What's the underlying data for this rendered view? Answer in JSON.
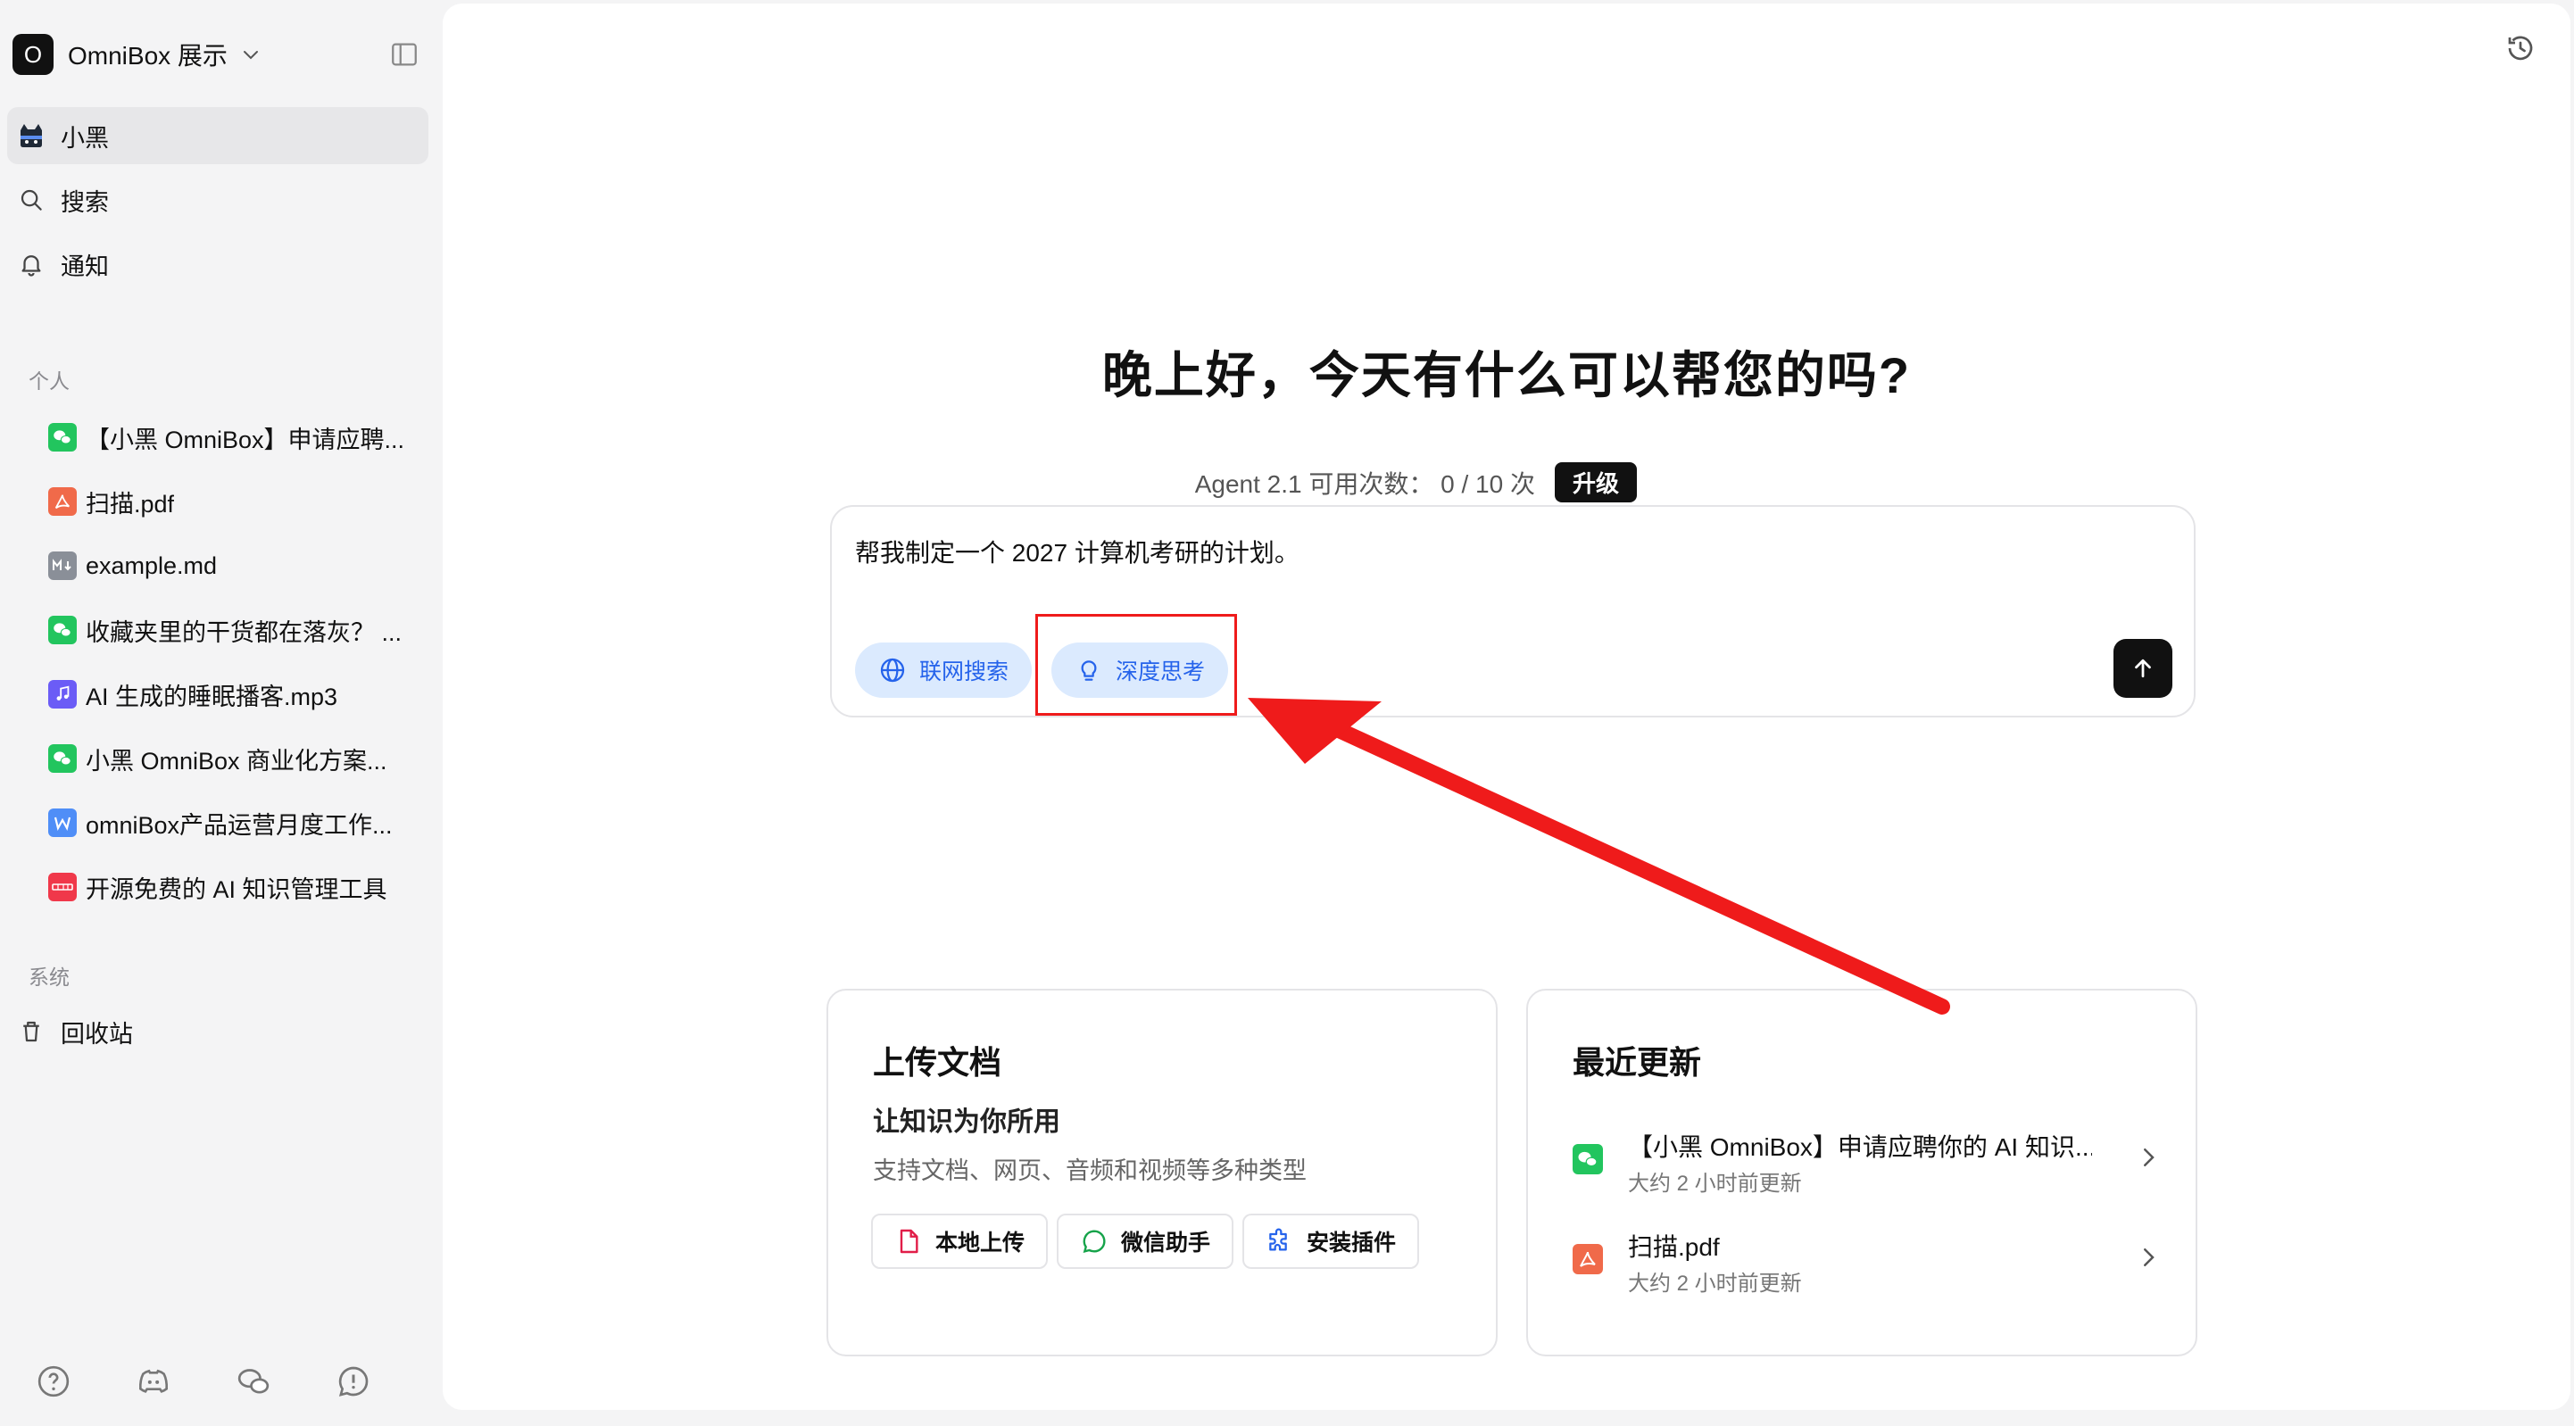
{
  "workspace": {
    "logo_letter": "O",
    "name": "OmniBox 展示"
  },
  "nav": [
    {
      "label": "小黑"
    },
    {
      "label": "搜索"
    },
    {
      "label": "通知"
    }
  ],
  "sections": {
    "personal": "个人",
    "system": "系统"
  },
  "docs": [
    {
      "label": "【小黑 OmniBox】申请应聘...",
      "icon": "wechat-icon",
      "color": "#22c55e"
    },
    {
      "label": "扫描.pdf",
      "icon": "pdf-icon",
      "color": "#f06a4a"
    },
    {
      "label": "example.md",
      "icon": "markdown-icon",
      "color": "#8a8f98"
    },
    {
      "label": "收藏夹里的干货都在落灰？ ...",
      "icon": "wechat-icon",
      "color": "#22c55e"
    },
    {
      "label": "AI 生成的睡眠播客.mp3",
      "icon": "audio-icon",
      "color": "#6b5cf6"
    },
    {
      "label": "小黑 OmniBox 商业化方案...",
      "icon": "wechat-icon",
      "color": "#22c55e"
    },
    {
      "label": "omniBox产品运营月度工作...",
      "icon": "word-icon",
      "color": "#4f8ef7"
    },
    {
      "label": "开源免费的 AI 知识管理工具",
      "icon": "web-icon",
      "color": "#f0384a"
    }
  ],
  "system_items": [
    {
      "label": "回收站"
    }
  ],
  "main": {
    "greeting": "晚上好，今天有什么可以帮您的吗?",
    "usage_text": "Agent 2.1 可用次数： 0 / 10 次",
    "upgrade_label": "升级",
    "prompt_text": "帮我制定一个 2027 计算机考研的计划。",
    "chip_web": "联网搜索",
    "chip_think": "深度思考"
  },
  "upload_card": {
    "title": "上传文档",
    "subtitle": "让知识为你所用",
    "desc": "支持文档、网页、音频和视频等多种类型",
    "btn_local": "本地上传",
    "btn_wechat": "微信助手",
    "btn_plugin": "安装插件"
  },
  "recent_card": {
    "title": "最近更新",
    "items": [
      {
        "title": "【小黑 OmniBox】申请应聘你的 AI 知识...",
        "time": "大约 2 小时前更新"
      },
      {
        "title": "扫描.pdf",
        "time": "大约 2 小时前更新"
      }
    ]
  },
  "colors": {
    "accent_blue": "#2563eb",
    "chip_bg": "#dbeafe",
    "annotation_red": "#ef1b1b"
  }
}
